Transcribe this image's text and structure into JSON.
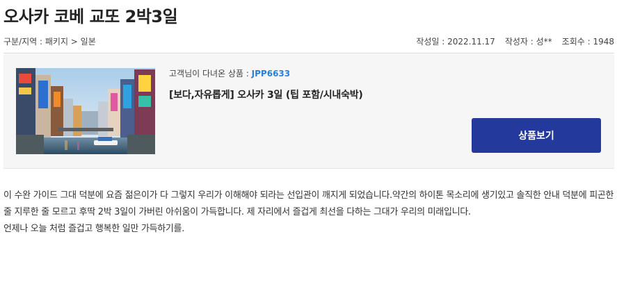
{
  "post": {
    "title": "오사카 코베 교또 2박3일",
    "category_label": "구분/지역 : 패키지 > 일본",
    "date_label": "작성일 : 2022.11.17",
    "author_label": "작성자 : 성**",
    "views_label": "조회수 : 1948"
  },
  "product": {
    "meta_prefix": "고객님이 다녀온 상품 : ",
    "code": "JPP6633",
    "name": "[보다,자유롭게] 오사카 3일 (팁 포함/시내숙박)",
    "button_label": "상품보기",
    "thumbnail_icon": "osaka-dotonbori-canal-image"
  },
  "content": {
    "paragraph_1": "이 수완 가이드 그대 덕분에 요즘 젊은이가 다 그렇지 우리가 이해해야 되라는 선입관이 깨지게 되었습니다.약간의 하이톤 목소리에 생기있고 솔직한 안내 덕분에 피곤한 줄 지루한 줄 모르고 후딱 2박 3일이 가버린 아쉬움이 가득합니다. 제 자리에서 즐겁게 최선을 다하는 그대가 우리의 미래입니다.",
    "paragraph_2": "언제나 오늘 처럼 즐겁고 행복한 일만 가득하기를."
  },
  "colors": {
    "button_bg": "#23399c",
    "code_color": "#2b7fd8",
    "box_bg": "#f6f6f6"
  }
}
